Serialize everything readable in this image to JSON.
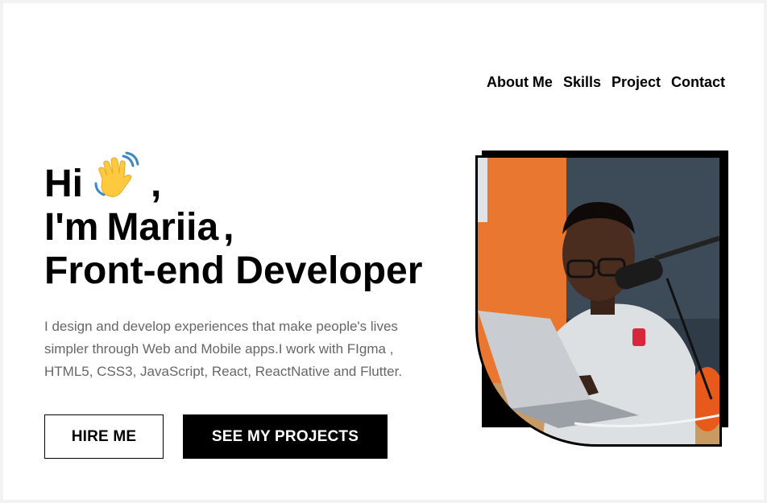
{
  "nav": {
    "items": [
      {
        "label": "About Me"
      },
      {
        "label": "Skills"
      },
      {
        "label": "Project"
      },
      {
        "label": "Contact"
      }
    ]
  },
  "hero": {
    "greeting": "Hi",
    "greeting_comma": ",",
    "intro": "I'm",
    "name": "Mariia",
    "name_comma": ",",
    "role": "Front-end Developer",
    "description": "I design and develop experiences that make people's lives simpler through Web and Mobile apps.I work with FIgma , HTML5, CSS3, JavaScript, React, ReactNative and Flutter."
  },
  "buttons": {
    "hire_label": "HIRE ME",
    "projects_label": "SEE MY PROJECTS"
  },
  "icons": {
    "wave": "waving-hand-icon"
  },
  "colors": {
    "text": "#000000",
    "description": "#666666",
    "background": "#ffffff",
    "button_dark": "#000000"
  }
}
